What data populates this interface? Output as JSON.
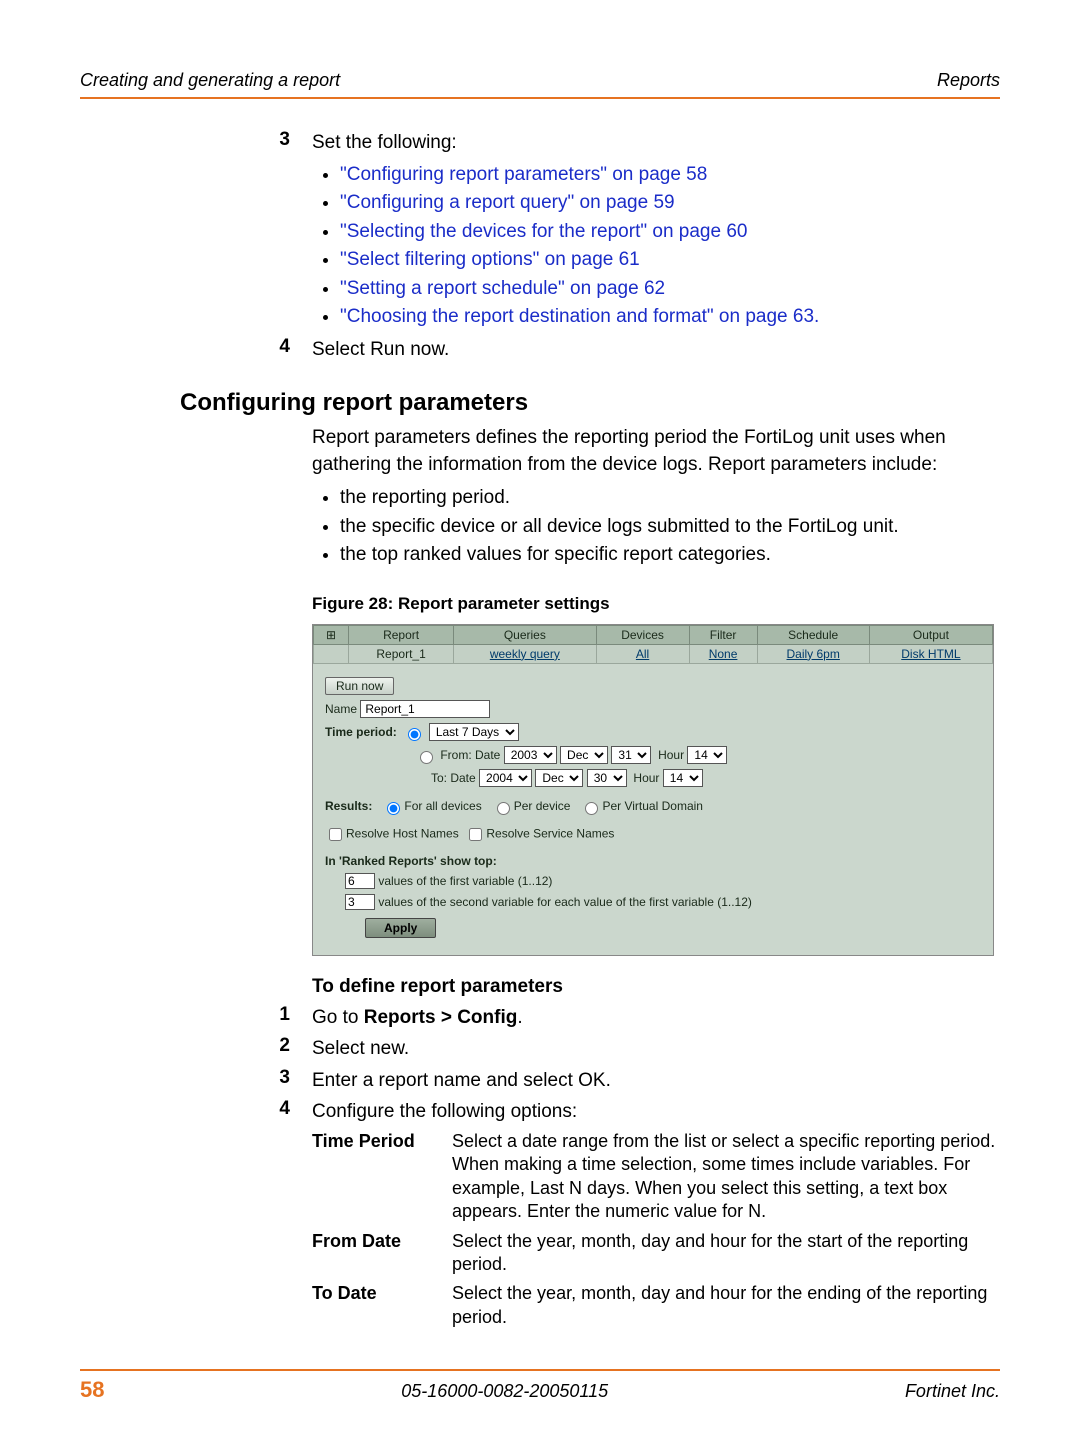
{
  "header": {
    "left": "Creating and generating a report",
    "right": "Reports"
  },
  "steps_top": [
    {
      "num": "3",
      "text": "Set the following:"
    }
  ],
  "cross_refs": [
    "\"Configuring report parameters\" on page 58",
    "\"Configuring a report query\" on page 59",
    "\"Selecting the devices for the report\" on page 60",
    "\"Select filtering options\" on page 61",
    "\"Setting a report schedule\" on page 62",
    "\"Choosing the report destination and format\" on page 63."
  ],
  "step4": {
    "num": "4",
    "text": "Select Run now."
  },
  "section_heading": "Configuring report parameters",
  "para1": "Report parameters defines the reporting period the FortiLog unit uses when gathering the information from the device logs. Report parameters include:",
  "param_bullets": [
    "the reporting period.",
    "the specific device or all device logs submitted to the FortiLog unit.",
    "the top ranked values for specific report categories."
  ],
  "figure_caption": "Figure 28: Report parameter settings",
  "shot": {
    "headers": [
      "Report",
      "Queries",
      "Devices",
      "Filter",
      "Schedule",
      "Output"
    ],
    "row": [
      "Report_1",
      "weekly query",
      "All",
      "None",
      "Daily 6pm",
      "Disk HTML"
    ],
    "run_now": "Run now",
    "name_label": "Name",
    "name_value": "Report_1",
    "time_period_label": "Time period:",
    "preset_value": "Last 7 Days",
    "from_label": "From: Date",
    "to_label": "To: Date",
    "from": {
      "year": "2003",
      "month": "Dec",
      "day": "31",
      "hour_label": "Hour",
      "hour": "14"
    },
    "to": {
      "year": "2004",
      "month": "Dec",
      "day": "30",
      "hour_label": "Hour",
      "hour": "14"
    },
    "results_label": "Results:",
    "results_opts": [
      "For all devices",
      "Per device",
      "Per Virtual Domain"
    ],
    "resolve_host": "Resolve Host Names",
    "resolve_service": "Resolve Service Names",
    "ranked_heading": "In 'Ranked Reports' show top:",
    "ranked1_val": "6",
    "ranked1_text": "values of the first variable (1..12)",
    "ranked2_val": "3",
    "ranked2_text": "values of the second variable for each value of the first variable (1..12)",
    "apply": "Apply"
  },
  "sub_heading": "To define report parameters",
  "steps_define": [
    {
      "num": "1",
      "pre": "Go to ",
      "bold": "Reports > Config",
      "post": "."
    },
    {
      "num": "2",
      "text": "Select new."
    },
    {
      "num": "3",
      "text": "Enter a report name and select OK."
    },
    {
      "num": "4",
      "text": "Configure the following options:"
    }
  ],
  "options": [
    {
      "label": "Time Period",
      "desc": "Select a date range from the list or select a specific reporting period. When making a time selection, some times include variables. For example, Last N days. When you select this setting, a text box appears. Enter the numeric value for N."
    },
    {
      "label": "From Date",
      "desc": "Select the year, month, day and hour for the start of the reporting period."
    },
    {
      "label": "To Date",
      "desc": "Select the year, month, day and hour for the ending of the reporting period."
    }
  ],
  "footer": {
    "page": "58",
    "mid": "05-16000-0082-20050115",
    "right": "Fortinet Inc."
  }
}
